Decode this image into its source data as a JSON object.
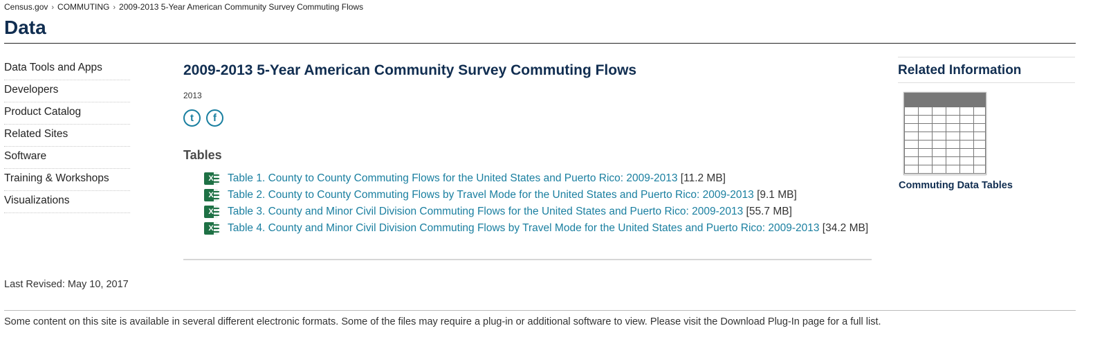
{
  "breadcrumb": {
    "items": [
      "Census.gov",
      "COMMUTING",
      "2009-2013 5-Year American Community Survey Commuting Flows"
    ],
    "separator": "›"
  },
  "page_title": "Data",
  "sidenav": {
    "items": [
      {
        "label": "Data Tools and Apps"
      },
      {
        "label": "Developers"
      },
      {
        "label": "Product Catalog"
      },
      {
        "label": "Related Sites"
      },
      {
        "label": "Software"
      },
      {
        "label": "Training & Workshops"
      },
      {
        "label": "Visualizations"
      }
    ]
  },
  "main": {
    "heading": "2009-2013 5-Year American Community Survey Commuting Flows",
    "year": "2013",
    "social": {
      "twitter_icon": "t",
      "facebook_icon": "f"
    },
    "tables_heading": "Tables",
    "tables": [
      {
        "link": "Table 1. County to County Commuting Flows for the United States and Puerto Rico: 2009-2013",
        "size": " [11.2 MB]"
      },
      {
        "link": "Table 2. County to County Commuting Flows by Travel Mode for the United States and Puerto Rico: 2009-2013",
        "size": " [9.1 MB]"
      },
      {
        "link": "Table 3. County and Minor Civil Division Commuting Flows for the United States and Puerto Rico: 2009-2013",
        "size": " [55.7 MB]"
      },
      {
        "link": "Table 4. County and Minor Civil Division Commuting Flows by Travel Mode for the United States and Puerto Rico: 2009-2013",
        "size": " [34.2 MB]"
      }
    ],
    "file_icon_letter": "X"
  },
  "related": {
    "heading": "Related Information",
    "caption": "Commuting Data Tables"
  },
  "last_revised": "Last Revised: May 10, 2017",
  "footer_note": "Some content on this site is available in several different electronic formats. Some of the files may require a plug-in or additional software to view. Please visit the Download Plug-In page for a full list.",
  "colors": {
    "link": "#1a7fa0",
    "heading": "#112e51",
    "excel": "#1e7145"
  }
}
